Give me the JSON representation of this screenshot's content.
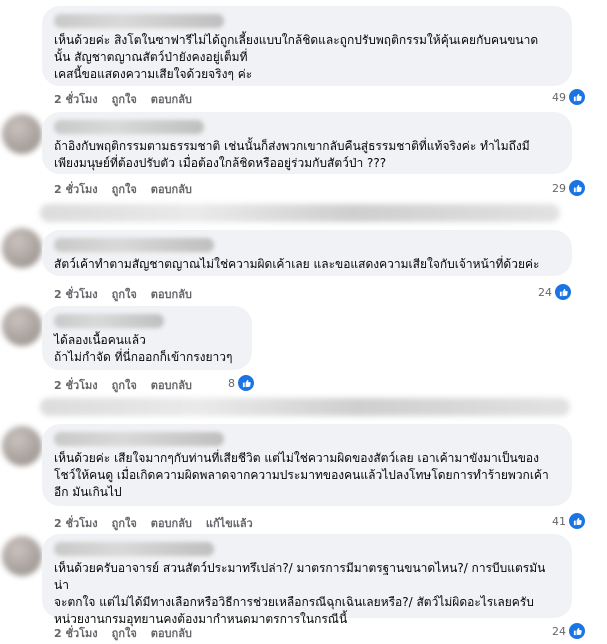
{
  "comments": [
    {
      "text": "เห็นด้วยค่ะ สิงโตในซาฟารีไม่ได้ถูกเลี้ยงแบบใกล้ชิดและถูกปรับพฤติกรรมให้คุ้นเคยกับคนขนาด\nนั้น สัญชาตญาณสัตว์ป่ายังคงอยู่เต็มที่\nเคสนี้ขอแสดงความเสียใจด้วยจริงๆ ค่ะ",
      "time": "2 ชั่วโมง",
      "like": "ถูกใจ",
      "reply": "ตอบกลับ",
      "likes": "49"
    },
    {
      "text": "ถ้าอิงกับพฤติกรรมตามธรรมชาติ เช่นนั้นก็ส่งพวกเขากลับคืนสู่ธรรมชาติที่แท้จริงค่ะ ทำไมถึงมี\nเพียงมนุษย์ที่ต้องปรับตัว เมื่อต้องใกล้ชิดหรืออยู่ร่วมกับสัตว์ป่า ???",
      "time": "2 ชั่วโมง",
      "like": "ถูกใจ",
      "reply": "ตอบกลับ",
      "likes": "29"
    },
    {
      "text": "สัตว์เค้าทำตามสัญชาตญาณไม่ใช่ความผิดเค้าเลย และขอแสดงความเสียใจกับเจ้าหน้าที่ด้วยค่ะ",
      "time": "2 ชั่วโมง",
      "like": "ถูกใจ",
      "reply": "ตอบกลับ",
      "likes": "24"
    },
    {
      "text": "ได้ลองเนื้อคนแล้ว\nถ้าไม่กำจัด ที่นี่กออกก็เข้ากรงยาวๆ",
      "time": "2 ชั่วโมง",
      "like": "ถูกใจ",
      "reply": "ตอบกลับ",
      "likes": "8"
    },
    {
      "text": "เห็นด้วยค่ะ เสียใจมากๆกับท่านที่เสียชีวิต แต่ไม่ใช่ความผิดของสัตว์เลย เอาเค้ามาขังมาเป็นของ\nโชว์ให้คนดู เมื่อเกิดความผิดพลาดจากความประมาทของคนแล้วไปลงโทษโดยการทำร้ายพวกเค้า\nอีก มันเกินไป",
      "time": "2 ชั่วโมง",
      "like": "ถูกใจ",
      "reply": "ตอบกลับ",
      "edited": "แก้ไขแล้ว",
      "likes": "41"
    },
    {
      "text": "เห็นด้วยครับอาจารย์ สวนสัตว์ประมาทรึเปล่า?/ มาตรการมีมาตรฐานขนาดไหน?/ การบีบแตรมันน่า\nจะตกใจ แต่ไม่ได้มีทางเลือกหรือวิธีการช่วยเหลือกรณีฉุกเฉินเลยหรือ?/ สัตว์ไม่ผิดอะไรเลยครับ\nหน่วยงานกรมอุทยานคงต้องมากำหนดมาตรการในกรณีนี้",
      "time": "2 ชั่วโมง",
      "like": "ถูกใจ",
      "reply": "ตอบกลับ",
      "likes": "24"
    }
  ],
  "colors": {
    "bubble": "#f0f2f5",
    "meta": "#65676b",
    "like_badge": "#1b74e4"
  },
  "icons": {
    "like": "thumbs-up-icon"
  }
}
